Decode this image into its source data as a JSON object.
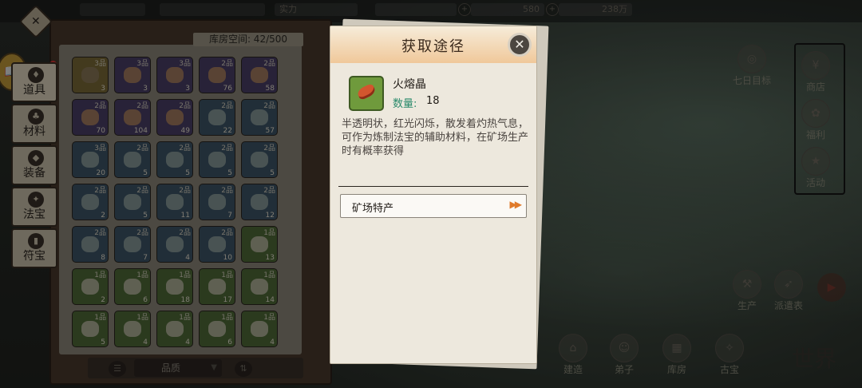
{
  "topbar": {
    "cells": [
      "1",
      "1",
      "",
      ""
    ],
    "power_label": "实力",
    "power_value": "",
    "resource1": "",
    "resource2": "580",
    "resource3": "238万"
  },
  "inventory": {
    "capacity_label": "库房空间: 42/500",
    "slots": [
      {
        "grade": "3品",
        "count": "3",
        "color": "c-yellow"
      },
      {
        "grade": "3品",
        "count": "3",
        "color": "c-purple"
      },
      {
        "grade": "3品",
        "count": "3",
        "color": "c-purple"
      },
      {
        "grade": "2品",
        "count": "76",
        "color": "c-purple"
      },
      {
        "grade": "2品",
        "count": "58",
        "color": "c-purple"
      },
      {
        "grade": "2品",
        "count": "70",
        "color": "c-purple"
      },
      {
        "grade": "2品",
        "count": "104",
        "color": "c-purple"
      },
      {
        "grade": "2品",
        "count": "49",
        "color": "c-purple"
      },
      {
        "grade": "2品",
        "count": "22",
        "color": "c-blue"
      },
      {
        "grade": "2品",
        "count": "57",
        "color": "c-blue"
      },
      {
        "grade": "3品",
        "count": "20",
        "color": "c-blue"
      },
      {
        "grade": "2品",
        "count": "5",
        "color": "c-blue"
      },
      {
        "grade": "2品",
        "count": "5",
        "color": "c-blue"
      },
      {
        "grade": "2品",
        "count": "5",
        "color": "c-blue"
      },
      {
        "grade": "2品",
        "count": "5",
        "color": "c-blue"
      },
      {
        "grade": "2品",
        "count": "2",
        "color": "c-blue"
      },
      {
        "grade": "2品",
        "count": "5",
        "color": "c-blue"
      },
      {
        "grade": "2品",
        "count": "11",
        "color": "c-blue"
      },
      {
        "grade": "2品",
        "count": "7",
        "color": "c-blue"
      },
      {
        "grade": "2品",
        "count": "12",
        "color": "c-blue"
      },
      {
        "grade": "2品",
        "count": "8",
        "color": "c-blue"
      },
      {
        "grade": "2品",
        "count": "7",
        "color": "c-blue"
      },
      {
        "grade": "2品",
        "count": "4",
        "color": "c-blue"
      },
      {
        "grade": "2品",
        "count": "10",
        "color": "c-blue"
      },
      {
        "grade": "1品",
        "count": "13",
        "color": "c-green"
      },
      {
        "grade": "1品",
        "count": "2",
        "color": "c-green"
      },
      {
        "grade": "1品",
        "count": "6",
        "color": "c-green"
      },
      {
        "grade": "1品",
        "count": "18",
        "color": "c-green"
      },
      {
        "grade": "1品",
        "count": "17",
        "color": "c-green"
      },
      {
        "grade": "1品",
        "count": "14",
        "color": "c-green"
      },
      {
        "grade": "1品",
        "count": "5",
        "color": "c-green"
      },
      {
        "grade": "1品",
        "count": "4",
        "color": "c-green"
      },
      {
        "grade": "1品",
        "count": "4",
        "color": "c-green"
      },
      {
        "grade": "1品",
        "count": "6",
        "color": "c-green"
      },
      {
        "grade": "1品",
        "count": "4",
        "color": "c-green"
      }
    ],
    "sort_quality_label": "品质"
  },
  "tabs": {
    "items": [
      {
        "label": "道具",
        "icon": "gourd-icon"
      },
      {
        "label": "材料",
        "icon": "herb-icon"
      },
      {
        "label": "装备",
        "icon": "armor-icon"
      },
      {
        "label": "法宝",
        "icon": "treasure-icon"
      },
      {
        "label": "符宝",
        "icon": "talisman-icon"
      }
    ]
  },
  "world": {
    "buttons": [
      {
        "label": "商店"
      },
      {
        "label": "福利"
      },
      {
        "label": "活动"
      },
      {
        "label": "七日目标"
      },
      {
        "label": "生产"
      },
      {
        "label": "派遣表"
      },
      {
        "label": "建造"
      },
      {
        "label": "弟子"
      },
      {
        "label": "库房"
      },
      {
        "label": "古宝"
      }
    ],
    "world_label": "世界"
  },
  "modal": {
    "title": "获取途径",
    "close_label": "✕",
    "item_name": "火熔晶",
    "qty_label": "数量:",
    "qty_value": "18",
    "description": "半透明状，红光闪烁，散发着灼热气息，可作为炼制法宝的辅助材料，在矿场生产时有概率获得",
    "sources": [
      {
        "label": "矿场特产",
        "arrow": "▶▶"
      }
    ]
  }
}
